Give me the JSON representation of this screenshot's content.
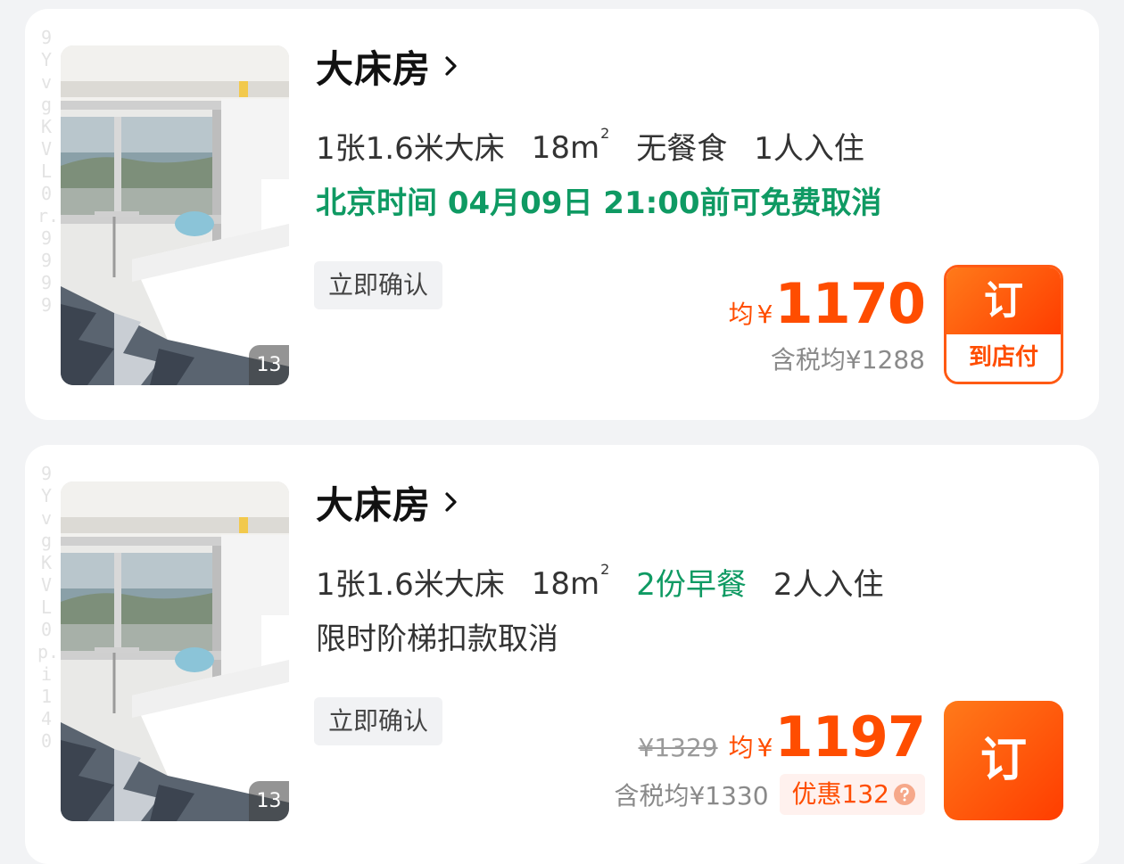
{
  "rooms": [
    {
      "watermark": "9YvgKVL0r.9999",
      "photo_count": "13",
      "title": "大床房",
      "bed": "1张1.6米大床",
      "area": "18m",
      "area_unit_sup": "2",
      "meal": "无餐食",
      "meal_highlight": false,
      "occupancy": "1人入住",
      "policy": "北京时间 04月09日 21:00前可免费取消",
      "policy_highlight": true,
      "confirm_tag": "立即确认",
      "original_price": "",
      "avg_label": "均",
      "currency": "¥",
      "price": "1170",
      "tax_included": "含税均¥1288",
      "discount": "",
      "book_label": "订",
      "book_sub_label": "到店付"
    },
    {
      "watermark": "9YvgKVL0p.i140",
      "photo_count": "13",
      "title": "大床房",
      "bed": "1张1.6米大床",
      "area": "18m",
      "area_unit_sup": "2",
      "meal": "2份早餐",
      "meal_highlight": true,
      "occupancy": "2人入住",
      "policy": "限时阶梯扣款取消",
      "policy_highlight": false,
      "confirm_tag": "立即确认",
      "original_price": "¥1329",
      "avg_label": "均",
      "currency": "¥",
      "price": "1197",
      "tax_included": "含税均¥1330",
      "discount": "优惠132",
      "book_label": "订",
      "book_sub_label": ""
    }
  ],
  "colors": {
    "accent": "#ff4d00",
    "green": "#0f9a63",
    "card_bg": "#ffffff",
    "page_bg": "#f2f3f5"
  },
  "icons": {
    "title_chevron": "chevron-right-icon",
    "discount_help": "question-circle-icon"
  }
}
